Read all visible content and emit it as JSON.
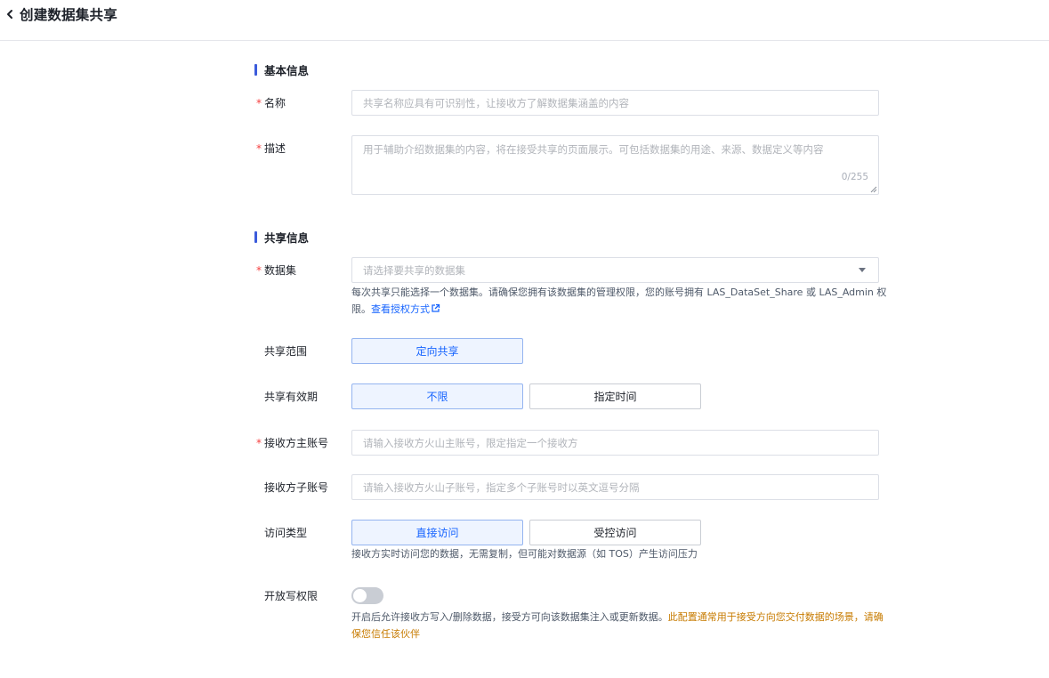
{
  "header": {
    "title": "创建数据集共享"
  },
  "sections": {
    "basic": "基本信息",
    "share": "共享信息"
  },
  "fields": {
    "name": {
      "label": "名称",
      "placeholder": "共享名称应具有可识别性，让接收方了解数据集涵盖的内容"
    },
    "description": {
      "label": "描述",
      "placeholder": "用于辅助介绍数据集的内容，将在接受共享的页面展示。可包括数据集的用途、来源、数据定义等内容",
      "counter": "0/255"
    },
    "dataset": {
      "label": "数据集",
      "placeholder": "请选择要共享的数据集",
      "hint_line1": "每次共享只能选择一个数据集。请确保您拥有该数据集的管理权限，您的账号拥有 LAS_DataSet_Share 或 LAS_Admin 权",
      "hint_line2": "限。",
      "hint_link": "查看授权方式"
    },
    "scope": {
      "label": "共享范围",
      "options": [
        "定向共享"
      ],
      "selected": "定向共享"
    },
    "validity": {
      "label": "共享有效期",
      "options": [
        "不限",
        "指定时间"
      ],
      "selected": "不限"
    },
    "main_account": {
      "label": "接收方主账号",
      "placeholder": "请输入接收方火山主账号，限定指定一个接收方"
    },
    "sub_account": {
      "label": "接收方子账号",
      "placeholder": "请输入接收方火山子账号，指定多个子账号时以英文逗号分隔"
    },
    "access_type": {
      "label": "访问类型",
      "options": [
        "直接访问",
        "受控访问"
      ],
      "selected": "直接访问",
      "hint": "接收方实时访问您的数据，无需复制，但可能对数据源（如 TOS）产生访问压力"
    },
    "write_permission": {
      "label": "开放写权限",
      "enabled": false,
      "hint_normal": "开启后允许接收方写入/删除数据，接受方可向该数据集注入或更新数据。",
      "hint_warn_line1": "此配置通常用于接受方向您交付数据的场景，请确",
      "hint_warn_line2": "保您信任该伙伴"
    }
  },
  "colors": {
    "accent": "#1664ff",
    "required": "#f53f3f",
    "warning": "#c77b00",
    "section_bar": "#3b5bdb"
  }
}
